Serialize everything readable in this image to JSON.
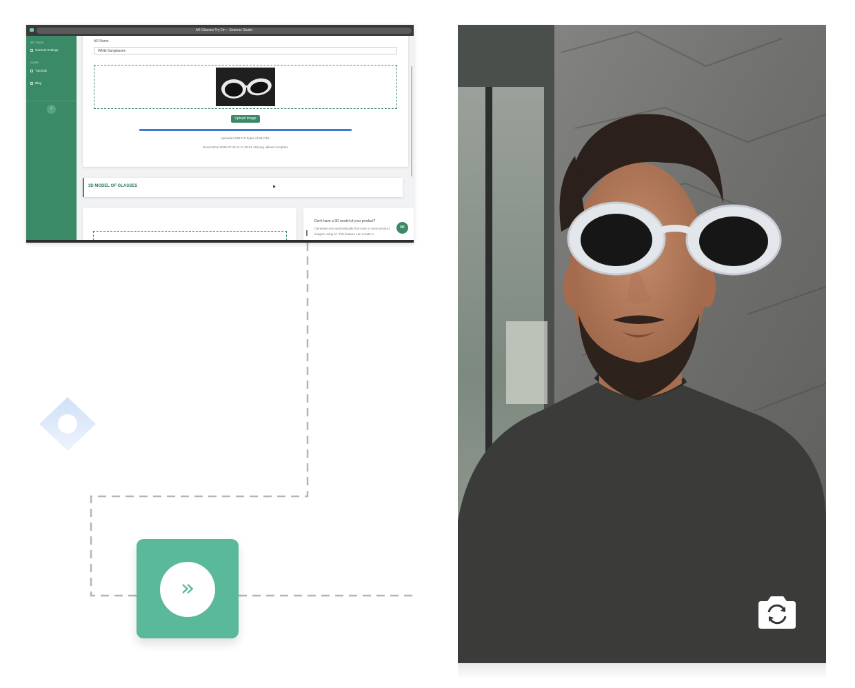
{
  "browser": {
    "title": "AR Glasses Try-On – Seamos Studio",
    "sidebar": {
      "section_settings": "SETTINGS",
      "item_settings": "General Settings",
      "section_guide": "GUIDE",
      "item_tutorials": "Tutorials",
      "item_blog": "Blog"
    },
    "form": {
      "ar_name_label": "AR Name",
      "ar_name_value": "White Sunglasses",
      "upload_button": "Upload Image",
      "upload_status": "Uploaded 851710 bytes of 851710.",
      "upload_file_status": "Screenshot 2025-07-31 at 11.39.51 AM.png upload complete",
      "progress": 1.0
    },
    "section_3d_title": "3D MODEL OF GLASSES",
    "promo": {
      "question": "Don't have a 3D model of your product?",
      "text": "Generate one automatically from one or more product images using AI. This feature can create a"
    }
  },
  "icons": {
    "forward": "double-chevron-right-icon",
    "mail": "envelope-icon",
    "switch_camera": "camera-switch-icon",
    "sidebar_collapse": "chevron-left-icon"
  },
  "colors": {
    "brand_green": "#3b8a67",
    "tile_green": "#59b99a",
    "progress_blue": "#3a7bd5"
  }
}
